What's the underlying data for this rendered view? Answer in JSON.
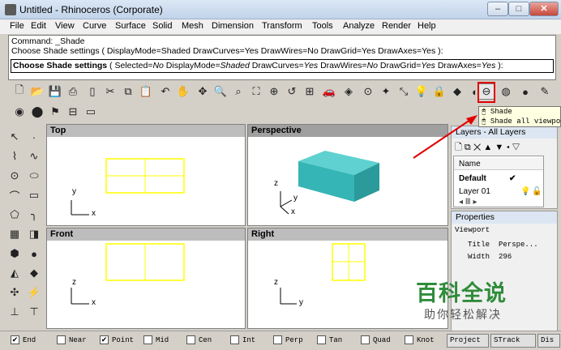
{
  "window": {
    "title": "Untitled - Rhinoceros (Corporate)"
  },
  "menu": [
    "File",
    "Edit",
    "View",
    "Curve",
    "Surface",
    "Solid",
    "Mesh",
    "Dimension",
    "Transform",
    "Tools",
    "Analyze",
    "Render",
    "Help"
  ],
  "command": {
    "line1": "Command: _Shade",
    "line2": "Choose Shade settings ( DisplayMode=Shaded  DrawCurves=Yes  DrawWires=No  DrawGrid=Yes  DrawAxes=Yes ):",
    "prompt_lead": "Choose Shade settings",
    "prompt_p1": "( Selected=",
    "prompt_v1": "No",
    "prompt_p2": " DisplayMode=",
    "prompt_v2": "Shaded",
    "prompt_p3": " DrawCurves=",
    "prompt_v3": "Yes",
    "prompt_p4": " DrawWires=",
    "prompt_v4": "No",
    "prompt_p5": " DrawGrid=",
    "prompt_v5": "Yes",
    "prompt_p6": " DrawAxes=",
    "prompt_v6": "Yes",
    "prompt_end": " ):"
  },
  "tooltip": {
    "item1": "Shade",
    "item2": "Shade all viewports"
  },
  "viewports": {
    "top": {
      "label": "Top",
      "axis_y": "y",
      "axis_x": "x"
    },
    "perspective": {
      "label": "Perspective",
      "axis_z": "z",
      "axis_y": "y",
      "axis_x": "x"
    },
    "front": {
      "label": "Front",
      "axis_z": "z",
      "axis_x": "x"
    },
    "right": {
      "label": "Right",
      "axis_z": "z",
      "axis_y": "y"
    }
  },
  "layers_panel": {
    "title": "Layers - All Layers",
    "header_name": "Name",
    "rows": [
      {
        "name": "Default",
        "current": "✔"
      },
      {
        "name": "Layer 01"
      }
    ]
  },
  "properties_panel": {
    "title": "Properties",
    "section": "Viewport",
    "rows": [
      {
        "key": "Title",
        "value": "Perspe..."
      },
      {
        "key": "Width",
        "value": "296"
      }
    ]
  },
  "watermark": {
    "main": "百科全说",
    "sub": "助你轻松解决"
  },
  "osnap": [
    {
      "label": "End",
      "checked": true
    },
    {
      "label": "Near",
      "checked": false
    },
    {
      "label": "Point",
      "checked": true
    },
    {
      "label": "Mid",
      "checked": false
    },
    {
      "label": "Cen",
      "checked": false
    },
    {
      "label": "Int",
      "checked": false
    },
    {
      "label": "Perp",
      "checked": false
    },
    {
      "label": "Tan",
      "checked": false
    },
    {
      "label": "Quad",
      "checked": false
    },
    {
      "label": "Knot",
      "checked": false
    }
  ],
  "status_buttons": [
    "Project",
    "STrack",
    "Dis"
  ],
  "colors": {
    "selection": "#ffff00",
    "box": "#35b5b5",
    "highlight": "#e00000",
    "watermark": "#2f8c3a"
  }
}
